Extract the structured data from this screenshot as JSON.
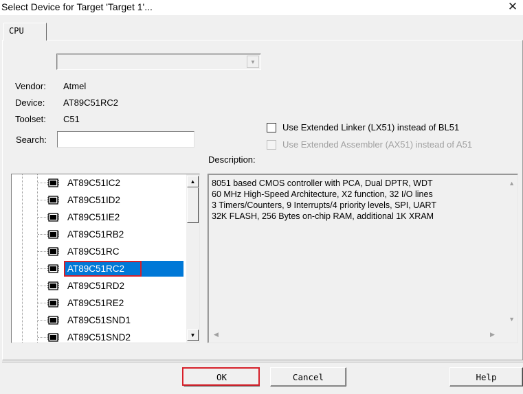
{
  "window": {
    "title": "Select Device for Target 'Target 1'...",
    "close_glyph": "✕"
  },
  "tabs": [
    {
      "label": "CPU"
    }
  ],
  "device_info": {
    "vendor_label": "Vendor:",
    "vendor_value": "Atmel",
    "device_label": "Device:",
    "device_value": "AT89C51RC2",
    "toolset_label": "Toolset:",
    "toolset_value": "C51",
    "search_label": "Search:",
    "search_value": ""
  },
  "options": {
    "extended_linker": {
      "label": "Use Extended Linker (LX51) instead of BL51",
      "checked": false,
      "enabled": true
    },
    "extended_assembler": {
      "label": "Use Extended Assembler (AX51) instead of A51",
      "checked": false,
      "enabled": false
    }
  },
  "description": {
    "label": "Description:",
    "text": "8051 based CMOS controller with PCA, Dual DPTR, WDT\n60 MHz High-Speed Architecture, X2 function, 32 I/O lines\n3 Timers/Counters, 9 Interrupts/4 priority levels, SPI, UART\n32K FLASH, 256 Bytes on-chip RAM, additional 1K XRAM"
  },
  "device_tree": {
    "items": [
      {
        "label": "AT89C51IC2",
        "selected": false
      },
      {
        "label": "AT89C51ID2",
        "selected": false
      },
      {
        "label": "AT89C51IE2",
        "selected": false
      },
      {
        "label": "AT89C51RB2",
        "selected": false
      },
      {
        "label": "AT89C51RC",
        "selected": false
      },
      {
        "label": "AT89C51RC2",
        "selected": true
      },
      {
        "label": "AT89C51RD2",
        "selected": false
      },
      {
        "label": "AT89C51RE2",
        "selected": false
      },
      {
        "label": "AT89C51SND1",
        "selected": false
      },
      {
        "label": "AT89C51SND2",
        "selected": false
      }
    ]
  },
  "buttons": {
    "ok": "OK",
    "cancel": "Cancel",
    "help": "Help"
  },
  "colors": {
    "selection": "#0078d7",
    "highlight_frame": "#d6202a",
    "dialog_bg": "#f0f0f0"
  }
}
